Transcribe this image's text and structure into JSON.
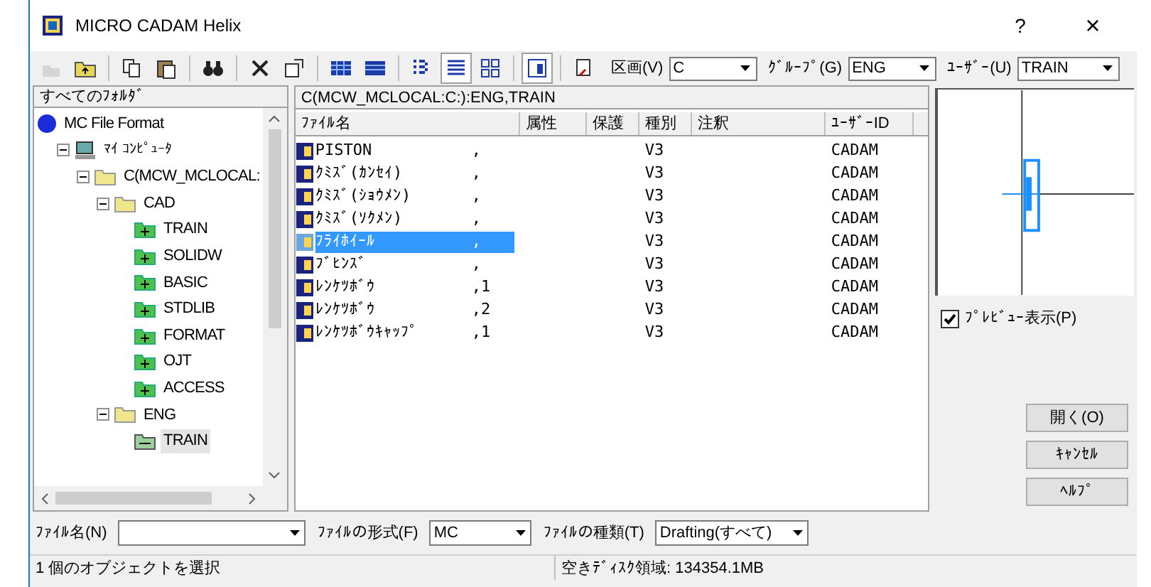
{
  "window": {
    "title": "MICRO CADAM Helix",
    "help": "?",
    "close": "×"
  },
  "toolbar": {
    "groups": [
      [
        {
          "kind": "new",
          "disabled": true,
          "pressed": false
        },
        {
          "kind": "up",
          "disabled": false,
          "pressed": false
        }
      ],
      [
        {
          "kind": "copy",
          "disabled": false,
          "pressed": false
        },
        {
          "kind": "paste",
          "disabled": false,
          "pressed": false
        }
      ],
      [
        {
          "kind": "find",
          "disabled": false,
          "pressed": false
        }
      ],
      [
        {
          "kind": "delete",
          "disabled": false,
          "pressed": false
        },
        {
          "kind": "props",
          "disabled": false,
          "pressed": false
        }
      ],
      [
        {
          "kind": "grid",
          "disabled": false,
          "pressed": false
        },
        {
          "kind": "grid2",
          "disabled": false,
          "pressed": false
        }
      ],
      [
        {
          "kind": "list",
          "disabled": false,
          "pressed": false
        },
        {
          "kind": "details",
          "disabled": false,
          "pressed": true
        },
        {
          "kind": "icons",
          "disabled": false,
          "pressed": false
        }
      ],
      [
        {
          "kind": "pane",
          "disabled": false,
          "pressed": true
        }
      ],
      [
        {
          "kind": "export",
          "disabled": false,
          "pressed": false
        }
      ]
    ],
    "combos": [
      {
        "label": "区画(V)",
        "value": "C"
      },
      {
        "label": "ｸﾞﾙｰﾌﾟ(G)",
        "value": "ENG"
      },
      {
        "label": "ﾕｰｻﾞｰ(U)",
        "value": "TRAIN"
      }
    ]
  },
  "folders": {
    "header": "すべてのﾌｫﾙﾀﾞ",
    "tree": [
      {
        "label": "MC File Format",
        "kind": "root",
        "selected": false,
        "children": [
          {
            "label": "ﾏｲ ｺﾝﾋﾟｭｰﾀ",
            "kind": "computer",
            "expanded": true,
            "selected": false,
            "children": [
              {
                "label": "C(MCW_MCLOCAL:",
                "kind": "folder",
                "expanded": true,
                "selected": false,
                "children": [
                  {
                    "label": "CAD",
                    "kind": "folder",
                    "expanded": true,
                    "selected": false,
                    "children": [
                      {
                        "label": "TRAIN",
                        "kind": "group",
                        "selected": false
                      },
                      {
                        "label": "SOLIDW",
                        "kind": "group",
                        "selected": false
                      },
                      {
                        "label": "BASIC",
                        "kind": "group",
                        "selected": false
                      },
                      {
                        "label": "STDLIB",
                        "kind": "group",
                        "selected": false
                      },
                      {
                        "label": "FORMAT",
                        "kind": "group",
                        "selected": false
                      },
                      {
                        "label": "OJT",
                        "kind": "group",
                        "selected": false
                      },
                      {
                        "label": "ACCESS",
                        "kind": "group",
                        "selected": false
                      }
                    ]
                  },
                  {
                    "label": "ENG",
                    "kind": "folder",
                    "expanded": true,
                    "selected": false,
                    "children": [
                      {
                        "label": "TRAIN",
                        "kind": "open-group",
                        "selected": true
                      }
                    ]
                  }
                ]
              }
            ]
          }
        ]
      }
    ]
  },
  "files": {
    "path": "C(MCW_MCLOCAL:C:):ENG,TRAIN",
    "columns": [
      "ﾌｧｲﾙ名",
      "属性",
      "保護",
      "種別",
      "注釈",
      "ﾕｰｻﾞｰID"
    ],
    "rows": [
      {
        "name": "PISTON",
        "suffix": ",",
        "type": "V3",
        "user": "CADAM",
        "selected": false
      },
      {
        "name": "ｸﾐｽﾞ(ｶﾝｾｲ)",
        "suffix": ",",
        "type": "V3",
        "user": "CADAM",
        "selected": false
      },
      {
        "name": "ｸﾐｽﾞ(ｼｮｳﾒﾝ)",
        "suffix": ",",
        "type": "V3",
        "user": "CADAM",
        "selected": false
      },
      {
        "name": "ｸﾐｽﾞ(ｿｸﾒﾝ)",
        "suffix": ",",
        "type": "V3",
        "user": "CADAM",
        "selected": false
      },
      {
        "name": "ﾌﾗｲﾎｲｰﾙ",
        "suffix": ",",
        "type": "V3",
        "user": "CADAM",
        "selected": true
      },
      {
        "name": "ﾌﾞﾋﾝｽﾞ",
        "suffix": ",",
        "type": "V3",
        "user": "CADAM",
        "selected": false
      },
      {
        "name": "ﾚﾝｹﾂﾎﾞｳ",
        "suffix": ",1",
        "type": "V3",
        "user": "CADAM",
        "selected": false
      },
      {
        "name": "ﾚﾝｹﾂﾎﾞｳ",
        "suffix": ",2",
        "type": "V3",
        "user": "CADAM",
        "selected": false
      },
      {
        "name": "ﾚﾝｹﾂﾎﾞｳｷｬｯﾌﾟ",
        "suffix": ",1",
        "type": "V3",
        "user": "CADAM",
        "selected": false
      }
    ]
  },
  "preview": {
    "checkbox": {
      "label": "ﾌﾟﾚﾋﾞｭｰ表示(P)",
      "checked": true
    }
  },
  "buttons": [
    "開く(O)",
    "ｷｬﾝｾﾙ",
    "ﾍﾙﾌﾟ"
  ],
  "bottom": {
    "filename": {
      "label": "ﾌｧｲﾙ名(N)"
    },
    "format": {
      "label": "ﾌｧｲﾙの形式(F)",
      "value": "MC"
    },
    "filetype": {
      "label": "ﾌｧｲﾙの種類(T)",
      "value": "Drafting(すべて)"
    }
  },
  "status_bar": [
    "1 個のオブジェクトを選択",
    "空きﾃﾞｨｽｸ領域: 134354.1MB"
  ]
}
